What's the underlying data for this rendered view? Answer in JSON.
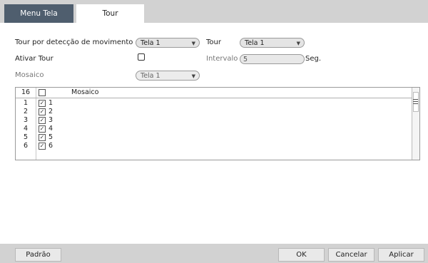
{
  "tabs": {
    "menu_tela": "Menu Tela",
    "tour": "Tour"
  },
  "form": {
    "motion_label": "Tour por detecção de movimento",
    "motion_select": "Tela 1",
    "tour_label": "Tour",
    "tour_select": "Tela 1",
    "enable_label": "Ativar Tour",
    "enable_checked": false,
    "interval_label": "Intervalo",
    "interval_value": "5",
    "interval_unit": "Seg.",
    "mosaic_label": "Mosaico",
    "mosaic_select": "Tela 1"
  },
  "table": {
    "header_num": "16",
    "header_label": "Mosaico",
    "rows": [
      {
        "num": "1",
        "checked": true,
        "label": "1"
      },
      {
        "num": "2",
        "checked": true,
        "label": "2"
      },
      {
        "num": "3",
        "checked": true,
        "label": "3"
      },
      {
        "num": "4",
        "checked": true,
        "label": "4"
      },
      {
        "num": "5",
        "checked": true,
        "label": "5"
      },
      {
        "num": "6",
        "checked": true,
        "label": "6"
      }
    ]
  },
  "buttons": {
    "default": "Padrão",
    "ok": "OK",
    "cancel": "Cancelar",
    "apply": "Aplicar"
  },
  "icons": {
    "dropdown": "chevron-down-icon",
    "check": "check-icon",
    "scroll": "scroll-handle-icon"
  }
}
